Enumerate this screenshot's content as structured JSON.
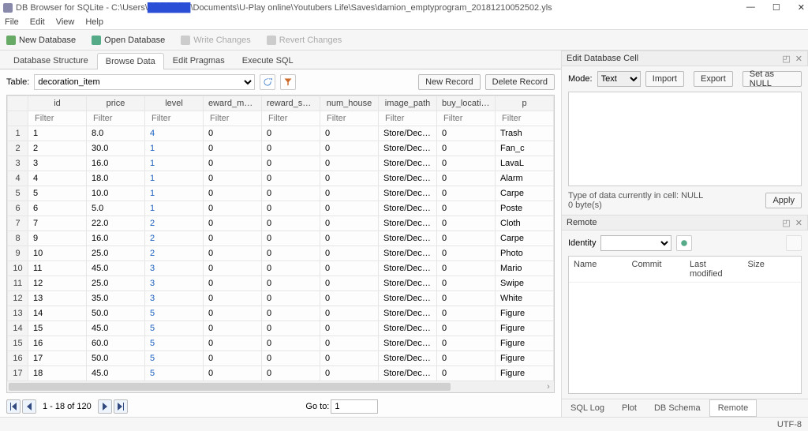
{
  "title_prefix": "DB Browser for SQLite - C:\\Users\\",
  "title_redacted": "███████",
  "title_suffix": "\\Documents\\U-Play online\\Youtubers Life\\Saves\\damion_emptyprogram_20181210052502.yls",
  "menus": [
    "File",
    "Edit",
    "View",
    "Help"
  ],
  "toolbar": {
    "new_db": "New Database",
    "open_db": "Open Database",
    "write_changes": "Write Changes",
    "revert_changes": "Revert Changes"
  },
  "main_tabs": [
    "Database Structure",
    "Browse Data",
    "Edit Pragmas",
    "Execute SQL"
  ],
  "main_tab_active": 1,
  "table_label": "Table:",
  "table_selected": "decoration_item",
  "grid_buttons": {
    "new_record": "New Record",
    "delete_record": "Delete Record"
  },
  "columns": [
    "id",
    "price",
    "level",
    "eward_motivatio",
    "reward_social",
    "num_house",
    "image_path",
    "buy_location",
    "p"
  ],
  "filter_placeholder": "Filter",
  "rows": [
    {
      "n": 1,
      "id": "1",
      "price": "8.0",
      "level": "4",
      "rm": "0",
      "rs": "0",
      "nh": "0",
      "ip": "Store/Deco_R...",
      "bl": "0",
      "p": "Trash"
    },
    {
      "n": 2,
      "id": "2",
      "price": "30.0",
      "level": "1",
      "rm": "0",
      "rs": "0",
      "nh": "0",
      "ip": "Store/Deco_R...",
      "bl": "0",
      "p": "Fan_c"
    },
    {
      "n": 3,
      "id": "3",
      "price": "16.0",
      "level": "1",
      "rm": "0",
      "rs": "0",
      "nh": "0",
      "ip": "Store/Deco_R...",
      "bl": "0",
      "p": "LavaL"
    },
    {
      "n": 4,
      "id": "4",
      "price": "18.0",
      "level": "1",
      "rm": "0",
      "rs": "0",
      "nh": "0",
      "ip": "Store/Deco_R...",
      "bl": "0",
      "p": "Alarm"
    },
    {
      "n": 5,
      "id": "5",
      "price": "10.0",
      "level": "1",
      "rm": "0",
      "rs": "0",
      "nh": "0",
      "ip": "Store/Deco_R...",
      "bl": "0",
      "p": "Carpe"
    },
    {
      "n": 6,
      "id": "6",
      "price": "5.0",
      "level": "1",
      "rm": "0",
      "rs": "0",
      "nh": "0",
      "ip": "Store/Deco_R...",
      "bl": "0",
      "p": "Poste"
    },
    {
      "n": 7,
      "id": "7",
      "price": "22.0",
      "level": "2",
      "rm": "0",
      "rs": "0",
      "nh": "0",
      "ip": "Store/Deco_R...",
      "bl": "0",
      "p": "Cloth"
    },
    {
      "n": 8,
      "id": "9",
      "price": "16.0",
      "level": "2",
      "rm": "0",
      "rs": "0",
      "nh": "0",
      "ip": "Store/Deco_R...",
      "bl": "0",
      "p": "Carpe"
    },
    {
      "n": 9,
      "id": "10",
      "price": "25.0",
      "level": "2",
      "rm": "0",
      "rs": "0",
      "nh": "0",
      "ip": "Store/Deco_R...",
      "bl": "0",
      "p": "Photo"
    },
    {
      "n": 10,
      "id": "11",
      "price": "45.0",
      "level": "3",
      "rm": "0",
      "rs": "0",
      "nh": "0",
      "ip": "Store/Deco_R...",
      "bl": "0",
      "p": "Mario"
    },
    {
      "n": 11,
      "id": "12",
      "price": "25.0",
      "level": "3",
      "rm": "0",
      "rs": "0",
      "nh": "0",
      "ip": "Store/Deco_R...",
      "bl": "0",
      "p": "Swipe"
    },
    {
      "n": 12,
      "id": "13",
      "price": "35.0",
      "level": "3",
      "rm": "0",
      "rs": "0",
      "nh": "0",
      "ip": "Store/Deco_R...",
      "bl": "0",
      "p": "White"
    },
    {
      "n": 13,
      "id": "14",
      "price": "50.0",
      "level": "5",
      "rm": "0",
      "rs": "0",
      "nh": "0",
      "ip": "Store/Deco_R...",
      "bl": "0",
      "p": "Figure"
    },
    {
      "n": 14,
      "id": "15",
      "price": "45.0",
      "level": "5",
      "rm": "0",
      "rs": "0",
      "nh": "0",
      "ip": "Store/Deco_R...",
      "bl": "0",
      "p": "Figure"
    },
    {
      "n": 15,
      "id": "16",
      "price": "60.0",
      "level": "5",
      "rm": "0",
      "rs": "0",
      "nh": "0",
      "ip": "Store/Deco_R...",
      "bl": "0",
      "p": "Figure"
    },
    {
      "n": 16,
      "id": "17",
      "price": "50.0",
      "level": "5",
      "rm": "0",
      "rs": "0",
      "nh": "0",
      "ip": "Store/Deco_R...",
      "bl": "0",
      "p": "Figure"
    },
    {
      "n": 17,
      "id": "18",
      "price": "45.0",
      "level": "5",
      "rm": "0",
      "rs": "0",
      "nh": "0",
      "ip": "Store/Deco_R...",
      "bl": "0",
      "p": "Figure"
    }
  ],
  "nav": {
    "range": "1 - 18 of 120",
    "goto_label": "Go to:",
    "goto_value": "1"
  },
  "edit_cell": {
    "title": "Edit Database Cell",
    "mode_label": "Mode:",
    "mode_value": "Text",
    "import": "Import",
    "export": "Export",
    "set_null": "Set as NULL",
    "type_info": "Type of data currently in cell: NULL",
    "size_info": "0 byte(s)",
    "apply": "Apply"
  },
  "remote": {
    "title": "Remote",
    "identity_label": "Identity",
    "headers": [
      "Name",
      "Commit",
      "Last modified",
      "Size"
    ]
  },
  "right_tabs": [
    "SQL Log",
    "Plot",
    "DB Schema",
    "Remote"
  ],
  "right_tab_active": 3,
  "status_encoding": "UTF-8"
}
